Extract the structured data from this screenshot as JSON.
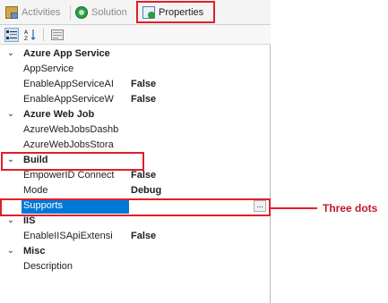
{
  "tabs": [
    {
      "label": "Activities",
      "icon": "activities-icon"
    },
    {
      "label": "Solution",
      "icon": "solution-icon"
    },
    {
      "label": "Properties",
      "icon": "properties-icon"
    }
  ],
  "toolbar": {
    "categorized": "categorized-icon",
    "alphabetical": "sort-alphabetical-icon",
    "property_pages": "property-pages-icon"
  },
  "grid": {
    "categories": {
      "azure_app_service": "Azure App Service",
      "azure_web_job": "Azure Web Job",
      "build": "Build",
      "iis": "IIS",
      "misc": "Misc"
    },
    "rows": {
      "app_service": {
        "name": "AppService",
        "value": ""
      },
      "enable_app_service_a": {
        "name": "EnableAppServiceAI",
        "value": "False"
      },
      "enable_app_service_w": {
        "name": "EnableAppServiceW",
        "value": "False"
      },
      "web_jobs_dash": {
        "name": "AzureWebJobsDashb",
        "value": ""
      },
      "web_jobs_stora": {
        "name": "AzureWebJobsStora",
        "value": ""
      },
      "empowerid_connect": {
        "name": "EmpowerID Connect",
        "value": "False"
      },
      "mode": {
        "name": "Mode",
        "value": "Debug"
      },
      "supports": {
        "name": "Supports",
        "value": ""
      },
      "enable_iis_api": {
        "name": "EnableIISApiExtensi",
        "value": "False"
      },
      "description": {
        "name": "Description",
        "value": ""
      }
    },
    "ellipsis_label": "...",
    "collapse_glyph": "⌄"
  },
  "annotation": {
    "callout": "Three dots",
    "highlight_color": "#e01f2a"
  },
  "colors": {
    "selection": "#0078d7"
  }
}
